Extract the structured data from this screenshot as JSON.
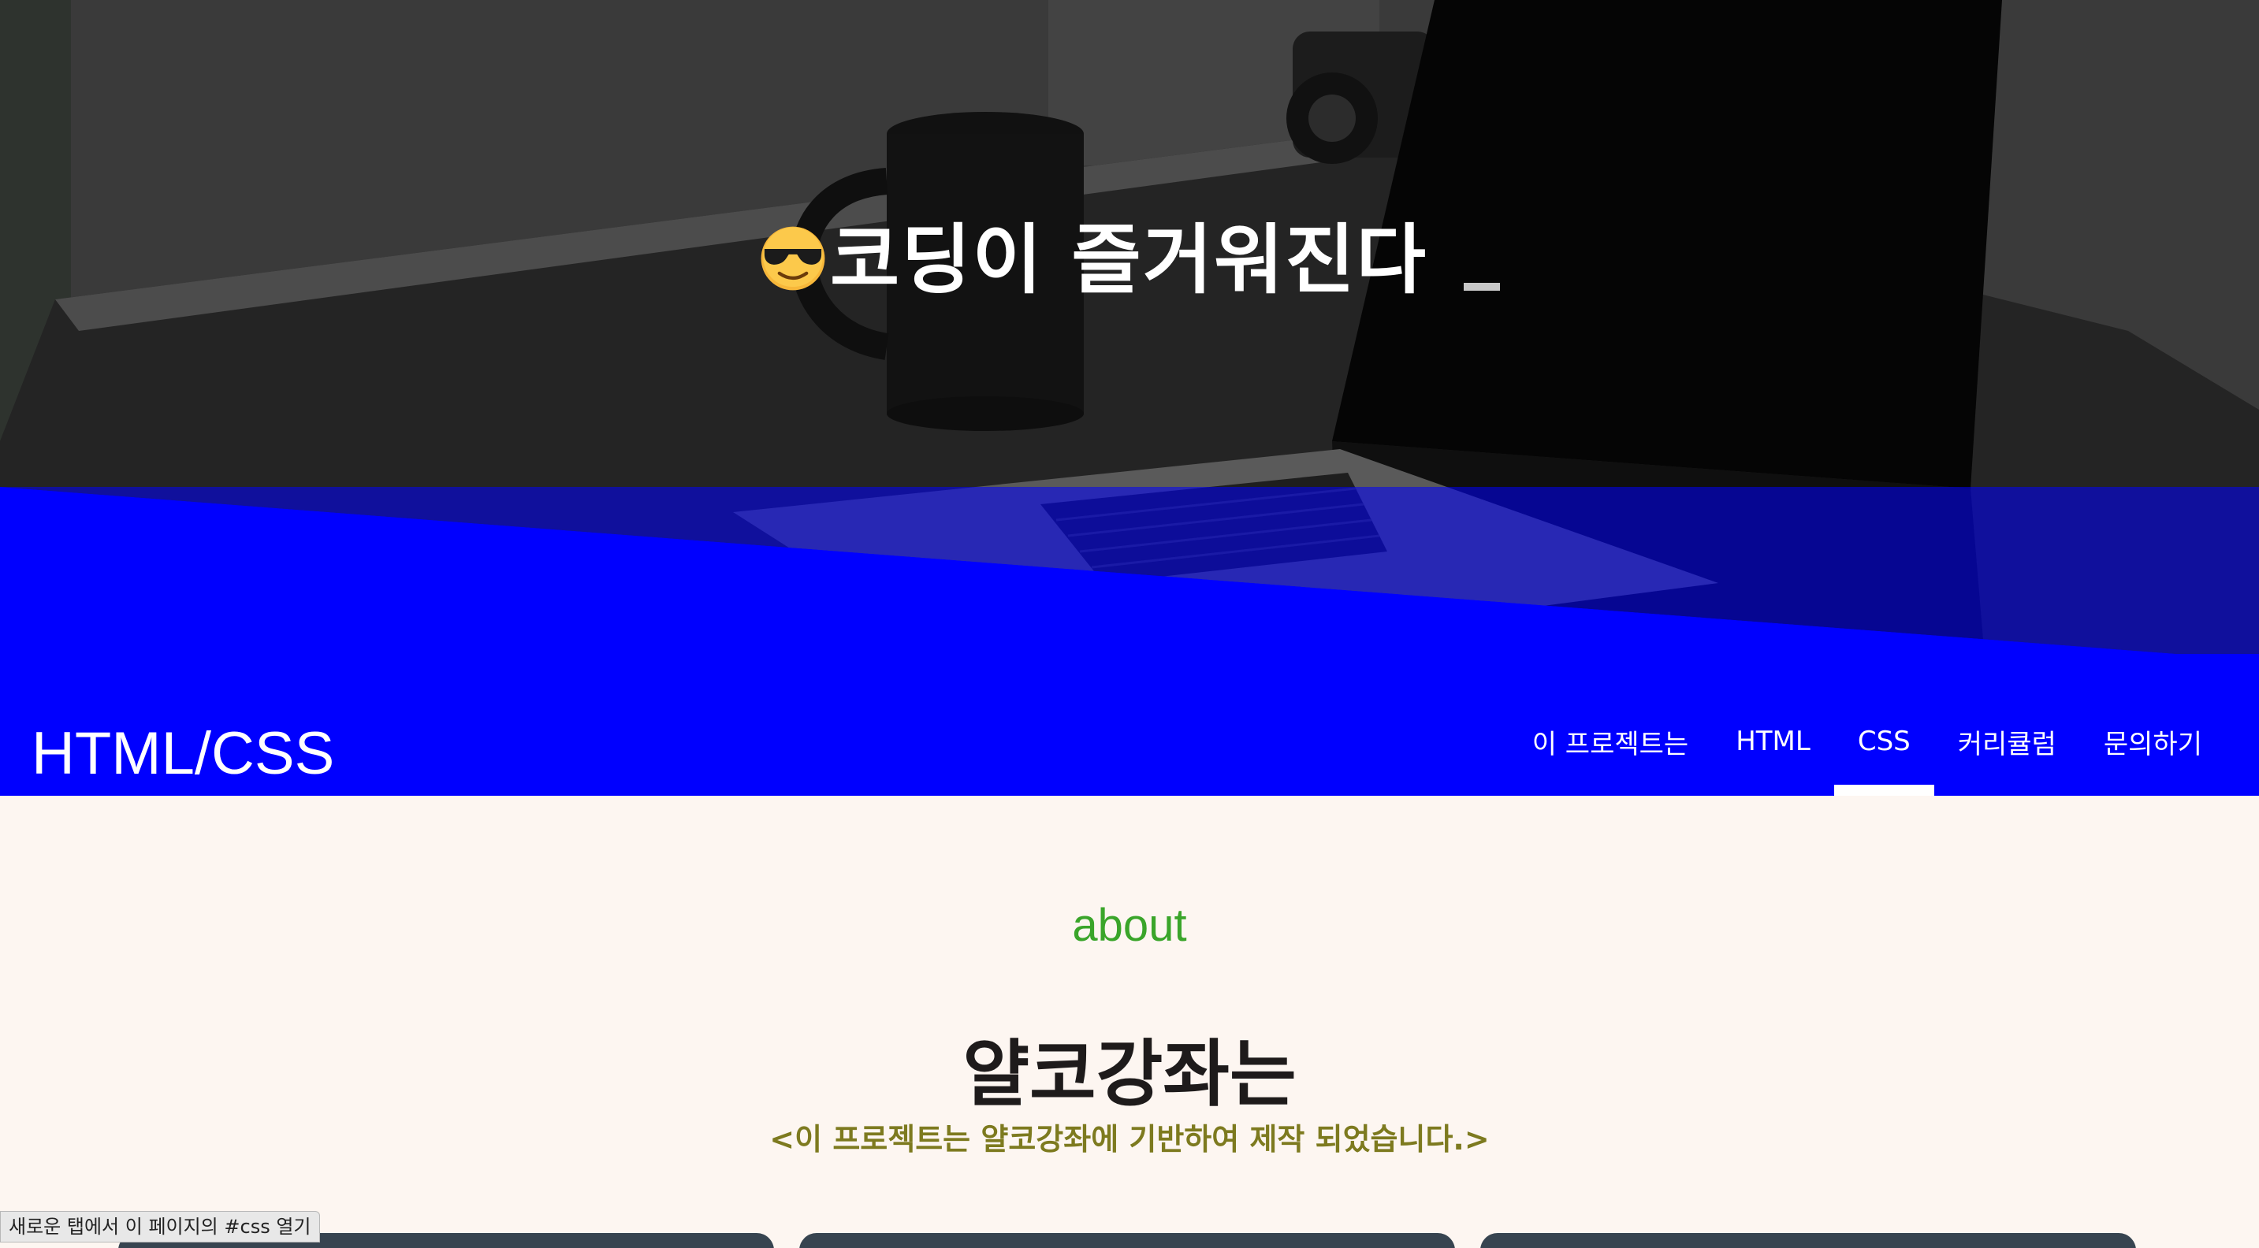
{
  "hero": {
    "title": "코딩이 즐거워진다",
    "emoji_icon": "sunglasses-face-icon"
  },
  "navbar": {
    "brand": "HTML/CSS",
    "items": [
      {
        "label": "이 프로젝트는",
        "active": false
      },
      {
        "label": "HTML",
        "active": false
      },
      {
        "label": "CSS",
        "active": true
      },
      {
        "label": "커리큘럼",
        "active": false
      },
      {
        "label": "문의하기",
        "active": false
      }
    ]
  },
  "about": {
    "kicker": "about",
    "title": "얄코강좌는",
    "subtitle": "<이 프로젝트는 얄코강좌에 기반하여 제작 되었습니다.>"
  },
  "status_bar": {
    "link_tip": "새로운 탭에서 이 페이지의 #css 열기"
  },
  "colors": {
    "nav_blue": "#0000ff",
    "kicker_green": "#3aa52a",
    "subtitle_olive": "#7d7a1f",
    "page_bg": "#fdf6f1",
    "card_dark": "#374450"
  }
}
